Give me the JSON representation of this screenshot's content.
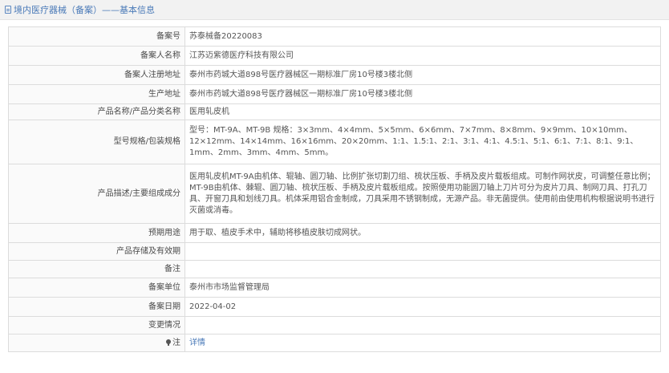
{
  "header": {
    "title": "境内医疗器械（备案）——基本信息"
  },
  "rows": [
    {
      "label": "备案号",
      "value": "苏泰械备20220083"
    },
    {
      "label": "备案人名称",
      "value": "江苏迈紫德医疗科技有限公司"
    },
    {
      "label": "备案人注册地址",
      "value": "泰州市药城大道898号医疗器械区一期标准厂房10号楼3楼北侧"
    },
    {
      "label": "生产地址",
      "value": "泰州市药城大道898号医疗器械区一期标准厂房10号楼3楼北侧"
    },
    {
      "label": "产品名称/产品分类名称",
      "value": "医用轧皮机"
    },
    {
      "label": "型号规格/包装规格",
      "value": "型号：MT-9A、MT-9B 规格：3×3mm、4×4mm、5×5mm、6×6mm、7×7mm、8×8mm、9×9mm、10×10mm、12×12mm、14×14mm、16×16mm、20×20mm、1:1、1.5:1、2:1、3:1、4:1、4.5:1、5:1、6:1、7:1、8:1、9:1、1mm、2mm、3mm、4mm、5mm。"
    },
    {
      "label": "产品描述/主要组成成分",
      "value": "医用轧皮机MT-9A由机体、辊轴、圆刀轴、比例扩张切割刀组、梳状压板、手柄及皮片载板组成。可制作网状皮，可调整任意比例；MT-9B由机体、棘辊、圆刀轴、梳状压板、手柄及皮片载板组成。按照使用功能圆刀轴上刀片可分为皮片刀具、制网刀具、打孔刀具、开窗刀具和划线刀具。机体采用铝合金制成，刀具采用不锈钢制成，无源产品。非无菌提供。使用前由使用机构根据说明书进行灭菌或消毒。"
    },
    {
      "label": "预期用途",
      "value": "用于取、植皮手术中，辅助将移植皮肤切成网状。"
    },
    {
      "label": "产品存储及有效期",
      "value": ""
    },
    {
      "label": "备注",
      "value": ""
    },
    {
      "label": "备案单位",
      "value": "泰州市市场监督管理局"
    },
    {
      "label": "备案日期",
      "value": "2022-04-02"
    },
    {
      "label": "变更情况",
      "value": ""
    }
  ],
  "footer_row": {
    "label": "注",
    "link_text": "详情"
  }
}
